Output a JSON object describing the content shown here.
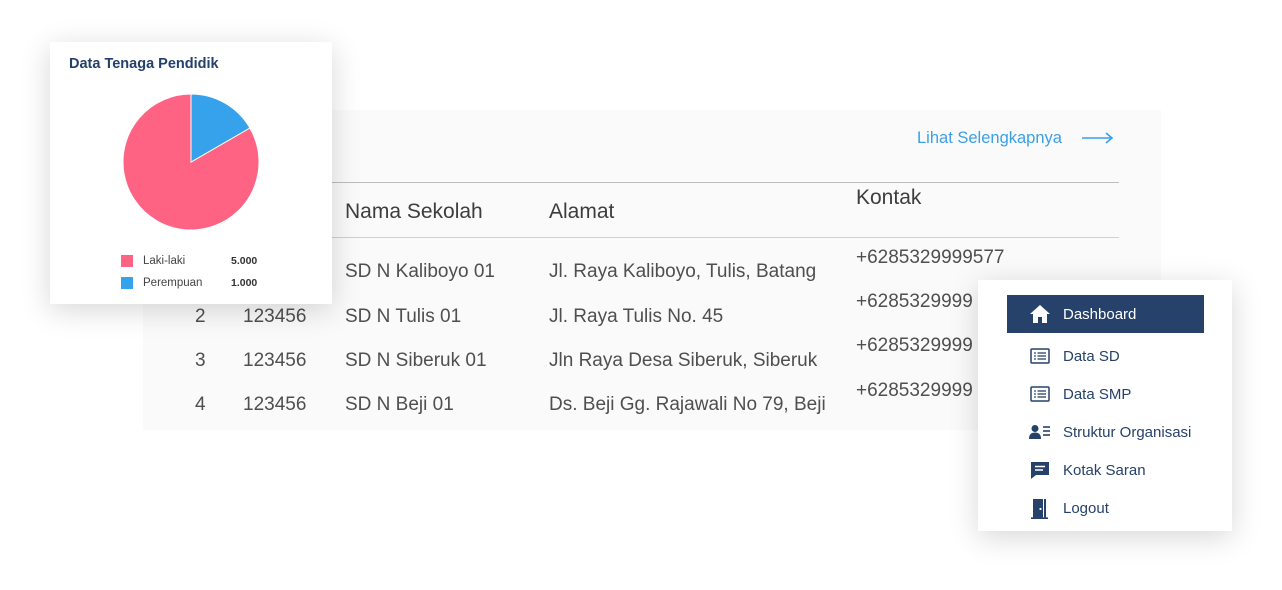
{
  "colors": {
    "accent": "#26426a",
    "link": "#3aa0e8",
    "male": "#ff6384",
    "female": "#36a2eb"
  },
  "table": {
    "see_more": "Lihat Selengkapnya",
    "headers": {
      "name": "Nama Sekolah",
      "address": "Alamat",
      "contact": "Kontak"
    },
    "rows": [
      {
        "no": "",
        "npsn": "",
        "name": "SD N Kaliboyo 01",
        "address": "Jl. Raya Kaliboyo, Tulis, Batang"
      },
      {
        "no": "2",
        "npsn": "123456",
        "name": "SD N Tulis 01",
        "address": "Jl. Raya Tulis No. 45"
      },
      {
        "no": "3",
        "npsn": "123456",
        "name": "SD N Siberuk 01",
        "address": "Jln Raya Desa Siberuk, Siberuk"
      },
      {
        "no": "4",
        "npsn": "123456",
        "name": "SD N Beji 01",
        "address": "Ds. Beji Gg. Rajawali No 79, Beji"
      }
    ],
    "contacts": [
      "+6285329999577",
      "+6285329999",
      "+6285329999",
      "+6285329999"
    ]
  },
  "pie_card": {
    "title": "Data Tenaga Pendidik",
    "legend": [
      {
        "label": "Laki-laki",
        "value": "5.000",
        "color": "#ff6384"
      },
      {
        "label": "Perempuan",
        "value": "1.000",
        "color": "#36a2eb"
      }
    ]
  },
  "chart_data": {
    "type": "pie",
    "title": "Data Tenaga Pendidik",
    "slices": [
      {
        "label": "Laki-laki",
        "value": 5000,
        "color": "#ff6384"
      },
      {
        "label": "Perempuan",
        "value": 1000,
        "color": "#36a2eb"
      }
    ],
    "legend_position": "bottom"
  },
  "menu": {
    "items": [
      {
        "label": "Dashboard",
        "icon": "home-icon",
        "active": true
      },
      {
        "label": "Data SD",
        "icon": "list-icon",
        "active": false
      },
      {
        "label": "Data SMP",
        "icon": "list-icon",
        "active": false
      },
      {
        "label": "Struktur Organisasi",
        "icon": "user-list-icon",
        "active": false
      },
      {
        "label": "Kotak Saran",
        "icon": "message-icon",
        "active": false
      },
      {
        "label": "Logout",
        "icon": "door-icon",
        "active": false
      }
    ]
  }
}
